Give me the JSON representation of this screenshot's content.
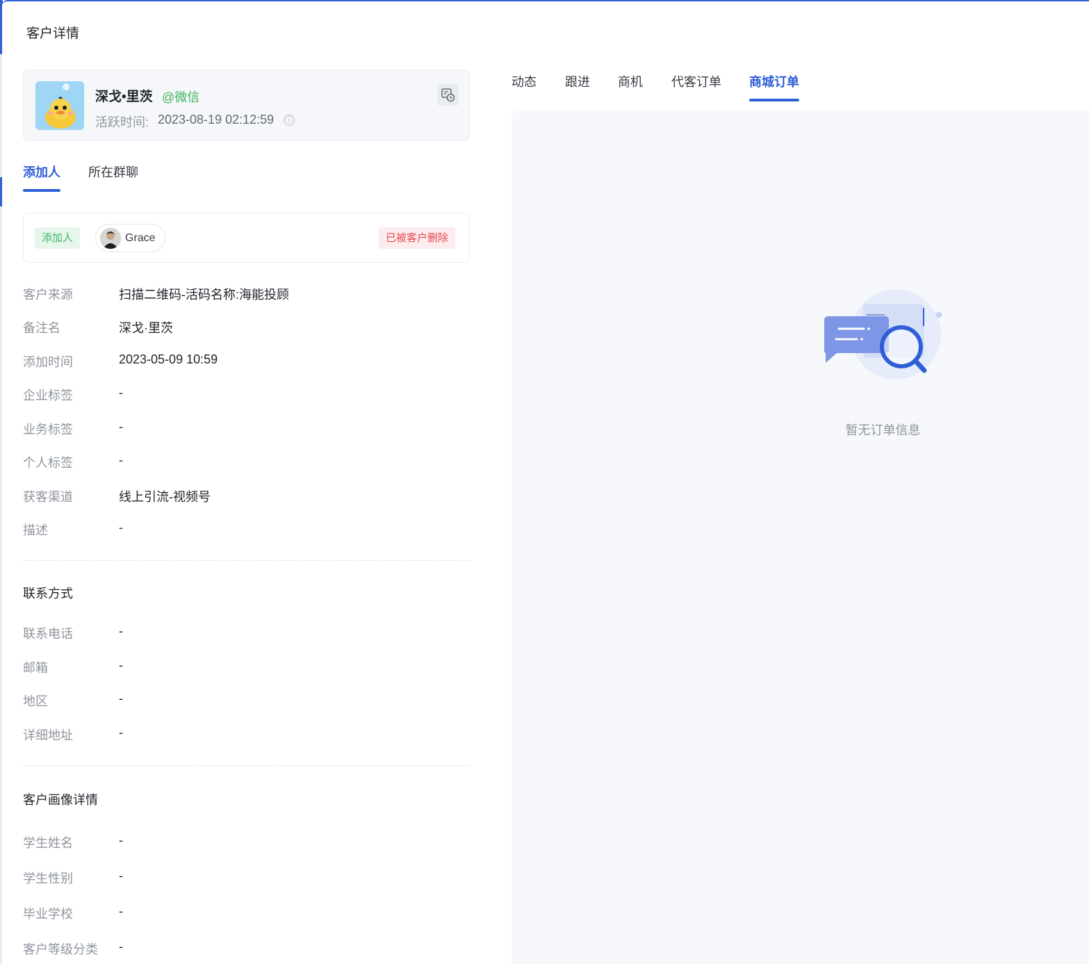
{
  "drawer": {
    "title": "客户详情"
  },
  "profile": {
    "name": "深戈•里茨",
    "platform": "@微信",
    "active_label": "活跃时间:",
    "active_time": "2023-08-19 02:12:59",
    "info_icon": "ⓘ"
  },
  "left_tabs": [
    {
      "label": "添加人",
      "active": true
    },
    {
      "label": "所在群聊",
      "active": false
    }
  ],
  "adder": {
    "tag": "添加人",
    "user_name": "Grace",
    "status": "已被客户删除"
  },
  "basic_fields": [
    {
      "label": "客户来源",
      "value": "扫描二维码-活码名称:海能投顾"
    },
    {
      "label": "备注名",
      "value": "深戈·里茨"
    },
    {
      "label": "添加时间",
      "value": "2023-05-09 10:59"
    },
    {
      "label": "企业标签",
      "value": "-"
    },
    {
      "label": "业务标签",
      "value": "-"
    },
    {
      "label": "个人标签",
      "value": "-"
    },
    {
      "label": "获客渠道",
      "value": "线上引流-视频号"
    },
    {
      "label": "描述",
      "value": "-"
    }
  ],
  "contact": {
    "title": "联系方式",
    "fields": [
      {
        "label": "联系电话",
        "value": "-"
      },
      {
        "label": "邮箱",
        "value": "-"
      },
      {
        "label": "地区",
        "value": "-"
      },
      {
        "label": "详细地址",
        "value": "-"
      }
    ]
  },
  "portrait": {
    "title": "客户画像详情",
    "fields": [
      {
        "label": "学生姓名",
        "value": "-"
      },
      {
        "label": "学生性别",
        "value": "-"
      },
      {
        "label": "毕业学校",
        "value": "-"
      },
      {
        "label": "客户等级分类",
        "value": "-"
      }
    ]
  },
  "right_tabs": [
    {
      "label": "动态",
      "active": false
    },
    {
      "label": "跟进",
      "active": false
    },
    {
      "label": "商机",
      "active": false
    },
    {
      "label": "代客订单",
      "active": false
    },
    {
      "label": "商城订单",
      "active": true
    }
  ],
  "empty_state": {
    "text": "暂无订单信息",
    "icon": "search-order-empty-illustration"
  },
  "colors": {
    "accent": "#2f5fd6",
    "green": "#3fb55f",
    "red": "#e5484d",
    "muted": "#8f959e"
  },
  "icons": {
    "history_button": "history-clock-icon",
    "info": "info-icon"
  }
}
